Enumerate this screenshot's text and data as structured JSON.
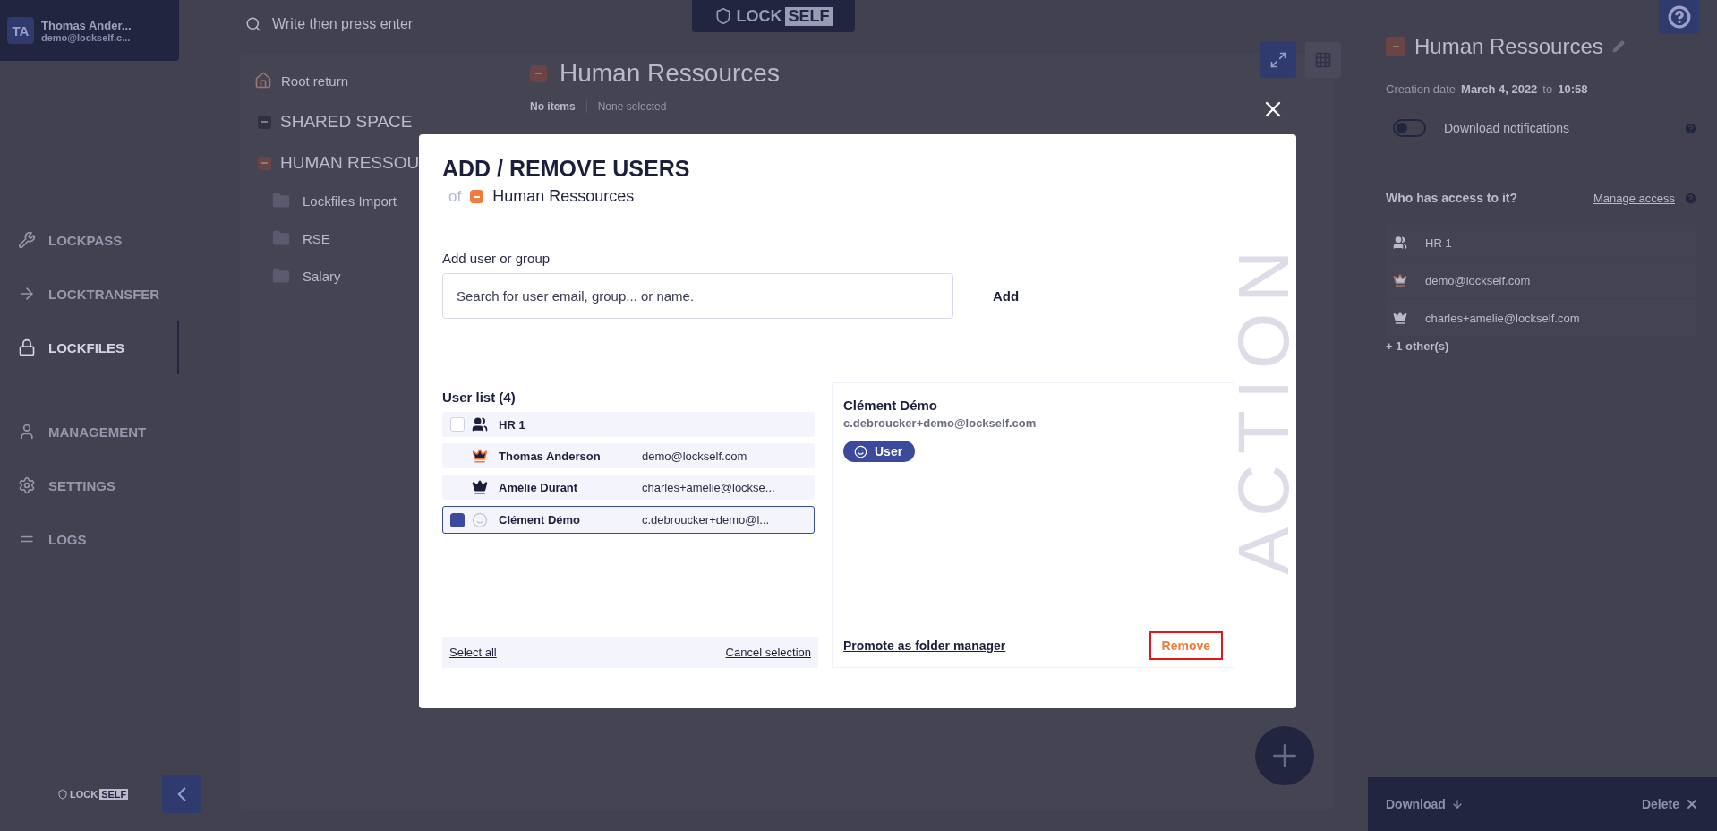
{
  "sidebar": {
    "user": {
      "initials": "TA",
      "name": "Thomas Ander...",
      "email": "demo@lockself.c..."
    },
    "nav": [
      {
        "label": "LOCKPASS",
        "selected": false
      },
      {
        "label": "LOCKTRANSFER",
        "selected": false
      },
      {
        "label": "LOCKFILES",
        "selected": true
      },
      {
        "label": "MANAGEMENT",
        "selected": false
      },
      {
        "label": "SETTINGS",
        "selected": false
      },
      {
        "label": "LOGS",
        "selected": false
      }
    ],
    "logo": {
      "part_1": "LOCK",
      "part_2": "SELF"
    }
  },
  "search": {
    "placeholder": "Write then press enter"
  },
  "top_logo": {
    "part_1": "LOCK",
    "part_2": "SELF"
  },
  "tree": {
    "root": "Root return",
    "spaces": [
      {
        "label": "SHARED SPACE",
        "color": "#2f3042"
      },
      {
        "label": "HUMAN RESSOU",
        "color": "#6b4545",
        "children": [
          {
            "label": "Lockfiles Import"
          },
          {
            "label": "RSE"
          },
          {
            "label": "Salary"
          }
        ]
      }
    ]
  },
  "folder": {
    "title": "Human Ressources",
    "count": "No items",
    "selection": "None selected"
  },
  "details": {
    "title": "Human Ressources",
    "created_label": "Creation date",
    "date": "March 4, 2022",
    "to": "to",
    "time": "10:58",
    "notifications": {
      "label": "Download notifications",
      "on": false
    },
    "access_title": "Who has access to it?",
    "manage": "Manage access",
    "access": [
      {
        "kind": "group",
        "label": "HR 1"
      },
      {
        "kind": "owner",
        "label": "demo@lockself.com"
      },
      {
        "kind": "manager",
        "label": "charles+amelie@lockself.com"
      }
    ],
    "more": "+ 1 other(s)"
  },
  "bottom_bar": {
    "download": "Download",
    "delete": "Delete"
  },
  "modal": {
    "title": "ADD / REMOVE USERS",
    "of": "of",
    "folder": "Human Ressources",
    "add_label": "Add user or group",
    "search": {
      "placeholder": "Search for user email, group... or name."
    },
    "add_button": "Add",
    "list_title": "User list (4)",
    "users": [
      {
        "kind": "group",
        "name": "HR 1",
        "checked": false,
        "selected": false
      },
      {
        "kind": "owner",
        "name": "Thomas Anderson",
        "email": "demo@lockself.com",
        "selected": false
      },
      {
        "kind": "manager",
        "name": "Amélie Durant",
        "email": "charles+amelie@lockse...",
        "selected": false
      },
      {
        "kind": "user",
        "name": "Clément Démo",
        "email": "c.debroucker+demo@l...",
        "checked": true,
        "selected": true
      }
    ],
    "select_all": "Select all",
    "cancel": "Cancel selection",
    "detail": {
      "name": "Clément Démo",
      "email": "c.debroucker+demo@lockself.com",
      "role": "User",
      "promote": "Promote as folder manager",
      "remove": "Remove"
    },
    "watermark": "ACTION"
  }
}
